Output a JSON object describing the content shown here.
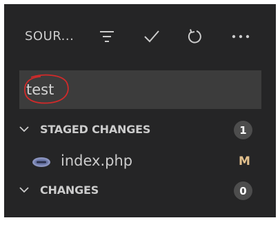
{
  "header": {
    "title": "SOUR...",
    "actions": [
      "filter-icon",
      "check-icon",
      "refresh-icon",
      "more-icon"
    ]
  },
  "commit": {
    "message": "test",
    "placeholder": ""
  },
  "staged": {
    "label": "STAGED CHANGES",
    "count": "1",
    "files": [
      {
        "name": "index.php",
        "status": "M",
        "icon": "php-file-icon"
      }
    ]
  },
  "changes": {
    "label": "CHANGES",
    "count": "0"
  },
  "colors": {
    "panel_bg": "#252526",
    "input_bg": "#3c3c3c",
    "badge_bg": "#4d4d4d",
    "modified": "#e2c08d",
    "annotation": "#d12a2a"
  }
}
